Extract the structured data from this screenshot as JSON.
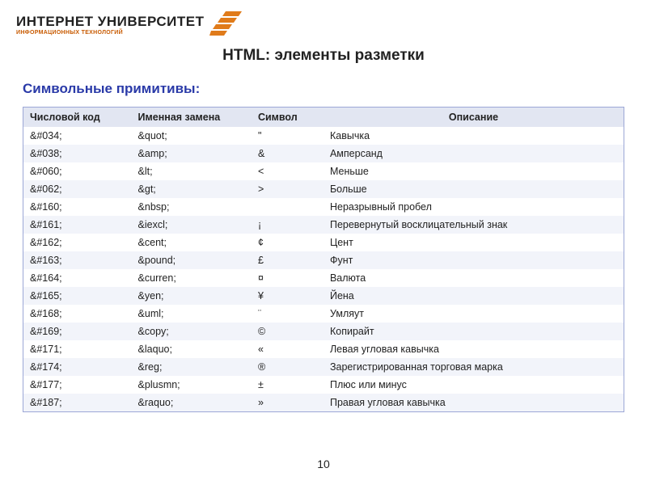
{
  "logo": {
    "main": "ИНТЕРНЕТ УНИВЕРСИТЕТ",
    "sub": "ИНФОРМАЦИОННЫХ ТЕХНОЛОГИЙ"
  },
  "slide_title": "HTML: элементы разметки",
  "section_title": "Символьные примитивы:",
  "table": {
    "headers": [
      "Числовой код",
      "Именная замена",
      "Символ",
      "Описание"
    ],
    "rows": [
      [
        "&#034;",
        "&quot;",
        "\"",
        "Кавычка"
      ],
      [
        "&#038;",
        "&amp;",
        "&",
        "Амперсанд"
      ],
      [
        "&#060;",
        "&lt;",
        "<",
        "Меньше"
      ],
      [
        "&#062;",
        "&gt;",
        ">",
        "Больше"
      ],
      [
        "&#160;",
        "&nbsp;",
        " ",
        "Неразрывный пробел"
      ],
      [
        "&#161;",
        "&iexcl;",
        "¡",
        "Перевернутый восклицательный знак"
      ],
      [
        "&#162;",
        "&cent;",
        "¢",
        "Цент"
      ],
      [
        "&#163;",
        "&pound;",
        "£",
        "Фунт"
      ],
      [
        "&#164;",
        "&curren;",
        "¤",
        "Валюта"
      ],
      [
        "&#165;",
        "&yen;",
        "¥",
        "Йена"
      ],
      [
        "&#168;",
        "&uml;",
        "¨",
        "Умляут"
      ],
      [
        "&#169;",
        "&copy;",
        "©",
        "Копирайт"
      ],
      [
        "&#171;",
        "&laquo;",
        "«",
        "Левая угловая кавычка"
      ],
      [
        "&#174;",
        "&reg;",
        "®",
        "Зарегистрированная торговая марка"
      ],
      [
        "&#177;",
        "&plusmn;",
        "±",
        "Плюс или минус"
      ],
      [
        "&#187;",
        "&raquo;",
        "»",
        "Правая угловая кавычка"
      ]
    ]
  },
  "page_number": "10"
}
